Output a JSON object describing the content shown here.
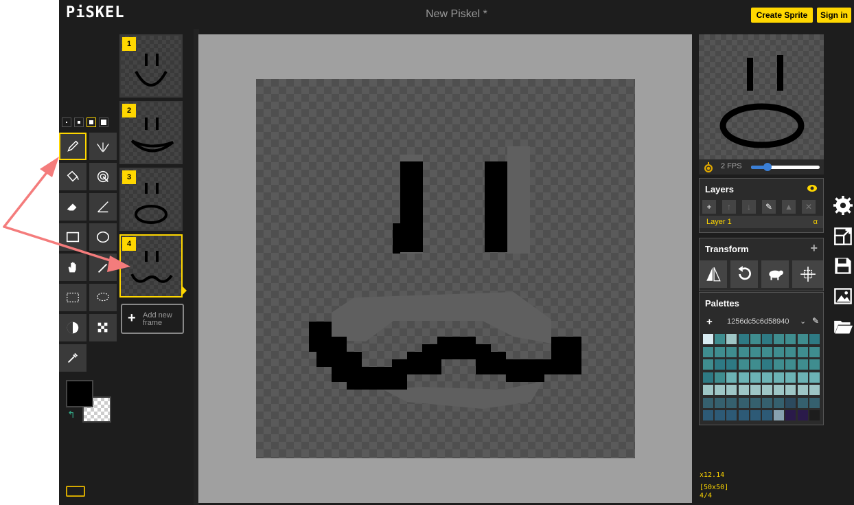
{
  "app": {
    "logo": "PiSKEL",
    "doc_title": "New Piskel *"
  },
  "header": {
    "create_sprite": "Create Sprite",
    "sign_in": "Sign in"
  },
  "frames": [
    {
      "number": "1"
    },
    {
      "number": "2"
    },
    {
      "number": "3"
    },
    {
      "number": "4"
    }
  ],
  "add_frame": {
    "label": "Add new frame"
  },
  "preview": {
    "fps_label": "2 FPS",
    "fps": 2
  },
  "layers": {
    "title": "Layers",
    "layer_name": "Layer 1",
    "alpha": "α"
  },
  "transform": {
    "title": "Transform"
  },
  "palettes": {
    "title": "Palettes",
    "selected": "1256dc5c6d58940",
    "colors": [
      "#d8ecf2",
      "#3f8d8f",
      "#9ec6c6",
      "#2e7a84",
      "#3f8d8f",
      "#2e7a84",
      "#3f8d8f",
      "#3f8d8f",
      "#3f8d8f",
      "#2e7a84",
      "#3f8d8f",
      "#3f8d8f",
      "#3f8d8f",
      "#3f8d8f",
      "#3f8d8f",
      "#3f8d8f",
      "#3f8d8f",
      "#3f8d8f",
      "#3f8d8f",
      "#3f8d8f",
      "#3f8d8f",
      "#2e7a84",
      "#2e7a84",
      "#3f8d8f",
      "#3f8d8f",
      "#2e7a84",
      "#3f8d8f",
      "#3f8d8f",
      "#3f8d8f",
      "#3f8d8f",
      "#2e7a84",
      "#3f8d8f",
      "#6cb3b5",
      "#6cb3b5",
      "#6cb3b5",
      "#6cb3b5",
      "#6cb3b5",
      "#6cb3b5",
      "#6cb3b5",
      "#6cb3b5",
      "#9ec6c6",
      "#9ec6c6",
      "#9ec6c6",
      "#9ec6c6",
      "#9ec6c6",
      "#9ec6c6",
      "#9ec6c6",
      "#9ec6c6",
      "#9ec6c6",
      "#9ec6c6",
      "#35606e",
      "#35606e",
      "#35606e",
      "#35606e",
      "#35606e",
      "#35606e",
      "#35606e",
      "#2c4a5e",
      "#35606e",
      "#35606e",
      "#2d5a76",
      "#2d5a76",
      "#2d5a76",
      "#2d5a76",
      "#2d5a76",
      "#2d5a76",
      "#87a2b0",
      "#2a1a4a",
      "#2a1a4a",
      "#1d1d1d"
    ]
  },
  "status": {
    "cursor": "x12.14",
    "size": "[50x50]",
    "frame": "4/4"
  },
  "colors": {
    "accent": "#ffd700",
    "primary_color": "#000000"
  }
}
